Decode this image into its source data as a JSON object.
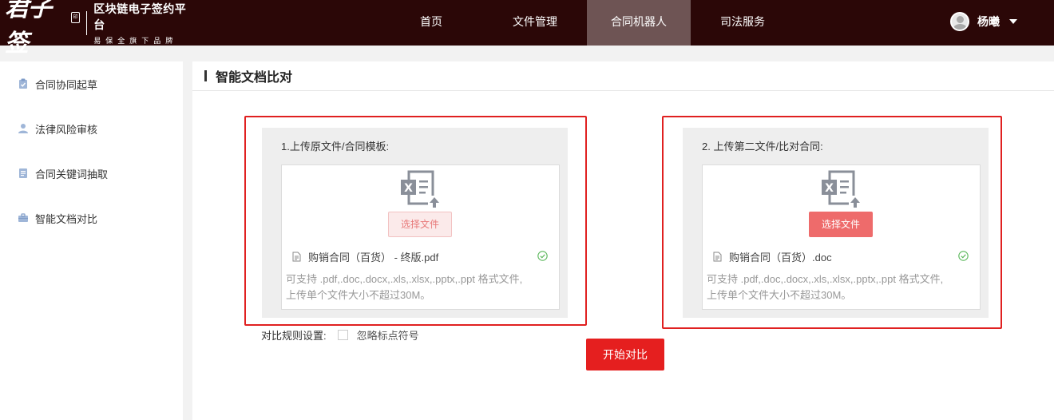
{
  "brand": {
    "name": "君子签",
    "tagline": "区块链电子签约平台",
    "subline": "易保全旗下品牌"
  },
  "nav": {
    "items": [
      "首页",
      "文件管理",
      "合同机器人",
      "司法服务"
    ],
    "active": "合同机器人"
  },
  "user": {
    "name": "杨曦"
  },
  "sidebar": {
    "items": [
      {
        "label": "合同协同起草",
        "icon": "clipboard-icon"
      },
      {
        "label": "法律风险审核",
        "icon": "user-icon"
      },
      {
        "label": "合同关键词抽取",
        "icon": "document-icon"
      },
      {
        "label": "智能文档对比",
        "icon": "briefcase-icon"
      }
    ]
  },
  "main": {
    "title": "智能文档比对"
  },
  "uploads": [
    {
      "label": "1.上传原文件/合同模板:",
      "button": "选择文件",
      "button_style": "light",
      "file_name": "购销合同（百货） - 终版.pdf",
      "hint_line1": "可支持 .pdf,.doc,.docx,.xls,.xlsx,.pptx,.ppt 格式文件,",
      "hint_line2": "上传单个文件大小不超过30M。"
    },
    {
      "label": "2. 上传第二文件/比对合同:",
      "button": "选择文件",
      "button_style": "solid",
      "file_name": "购销合同（百货）.doc",
      "hint_line1": "可支持 .pdf,.doc,.docx,.xls,.xlsx,.pptx,.ppt 格式文件,",
      "hint_line2": "上传单个文件大小不超过30M。"
    }
  ],
  "rules": {
    "label": "对比规则设置:",
    "option": "忽略标点符号",
    "checked": false
  },
  "start_button": "开始对比",
  "colors": {
    "topbar": "#2b0707",
    "nav_active": "#6e5454",
    "accent_red": "#e51f1f",
    "outline_red": "#e02020",
    "success_green": "#5cb85c"
  }
}
